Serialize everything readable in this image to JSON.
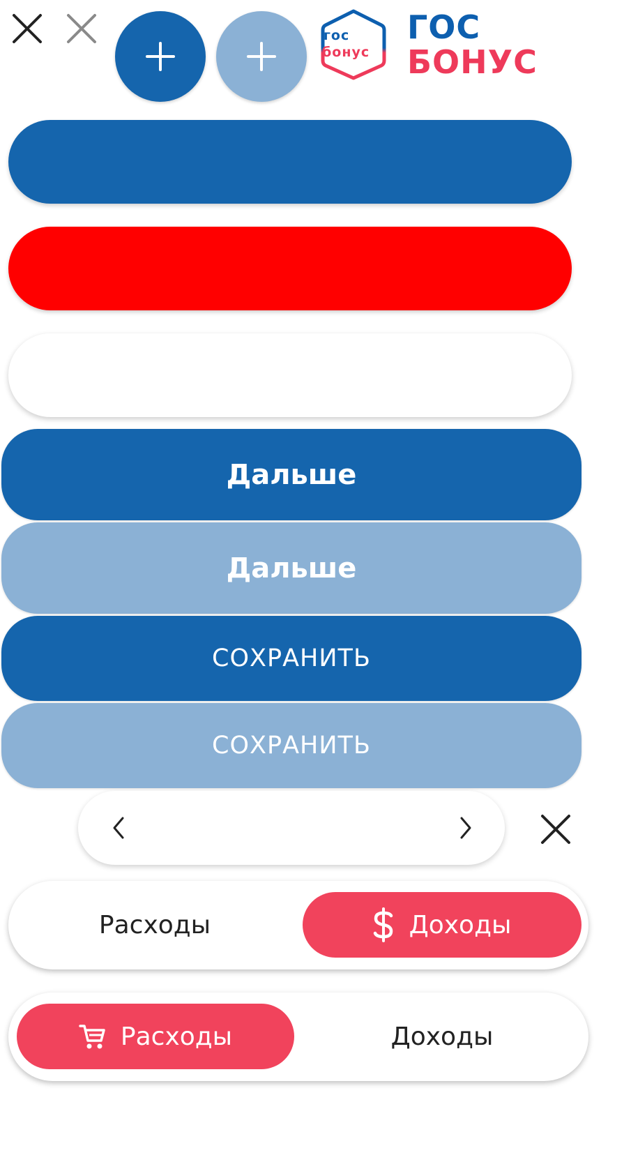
{
  "colors": {
    "primary": "#1565AD",
    "primary_light": "#8BB1D5",
    "danger": "#FF0000",
    "accent": "#F1435C",
    "logo_blue": "#0D5FAF",
    "logo_red": "#EE3A5A"
  },
  "logo": {
    "badge_line1": "гос",
    "badge_line2": "бонус",
    "word_line1": "ГОС",
    "word_line2": "БОНУС"
  },
  "buttons": {
    "next_label": "Дальше",
    "next_disabled_label": "Дальше",
    "save_label": "СОХРАНИТЬ",
    "save_disabled_label": "СОХРАНИТЬ"
  },
  "toggle_income": {
    "left_label": "Расходы",
    "right_label": "Доходы",
    "active": "right",
    "active_icon": "dollar-icon"
  },
  "toggle_expenses": {
    "left_label": "Расходы",
    "right_label": "Доходы",
    "active": "left",
    "active_icon": "cart-icon"
  }
}
